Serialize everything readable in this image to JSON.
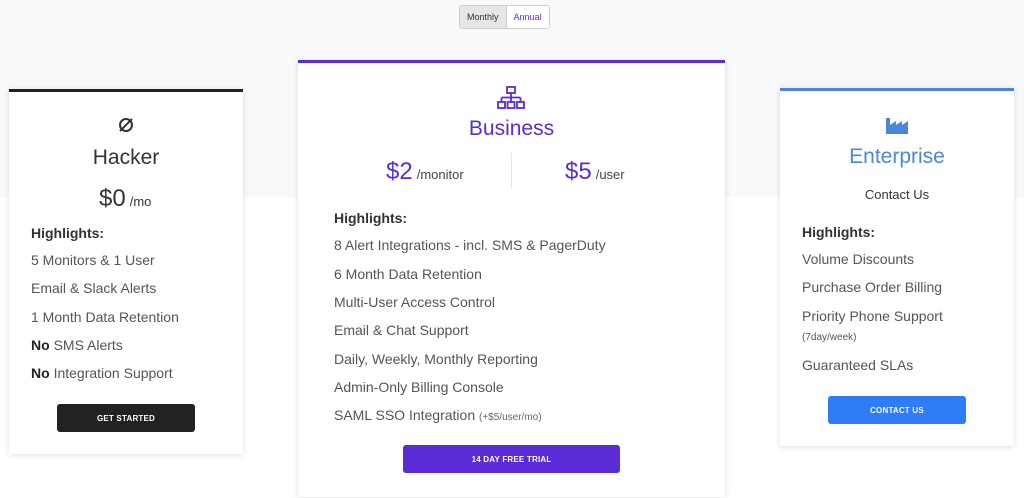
{
  "toggle": {
    "monthly": "Monthly",
    "annual": "Annual"
  },
  "hacker": {
    "name": "Hacker",
    "price": "$0",
    "price_unit": "/mo",
    "highlights": "Highlights:",
    "features": [
      "5 Monitors & 1 User",
      "Email & Slack Alerts",
      "1 Month Data Retention"
    ],
    "no_word": "No",
    "no_features": [
      "SMS Alerts",
      "Integration Support"
    ],
    "button": "GET STARTED",
    "icon": "ring-icon",
    "accent": "#222222"
  },
  "business": {
    "name": "Business",
    "price_monitor": "$2",
    "price_monitor_unit": "/monitor",
    "price_user": "$5",
    "price_user_unit": "/user",
    "highlights": "Highlights:",
    "features": [
      "8 Alert Integrations - incl. SMS & PagerDuty",
      "6 Month Data Retention",
      "Multi-User Access Control",
      "Email & Chat Support",
      "Daily, Weekly, Monthly Reporting",
      "Admin-Only Billing Console",
      "SAML SSO Integration"
    ],
    "sso_note": "(+$5/user/mo)",
    "button": "14 DAY FREE TRIAL",
    "icon": "org-chart-icon",
    "accent": "#5b2bd6"
  },
  "enterprise": {
    "name": "Enterprise",
    "contact": "Contact Us",
    "highlights": "Highlights:",
    "features": [
      "Volume Discounts",
      "Purchase Order Billing",
      "Priority Phone Support",
      "Guaranteed SLAs"
    ],
    "phone_note": "(7day/week)",
    "button": "CONTACT US",
    "icon": "factory-icon",
    "accent": "#4a86d9",
    "button_color": "#2e7cf6"
  }
}
